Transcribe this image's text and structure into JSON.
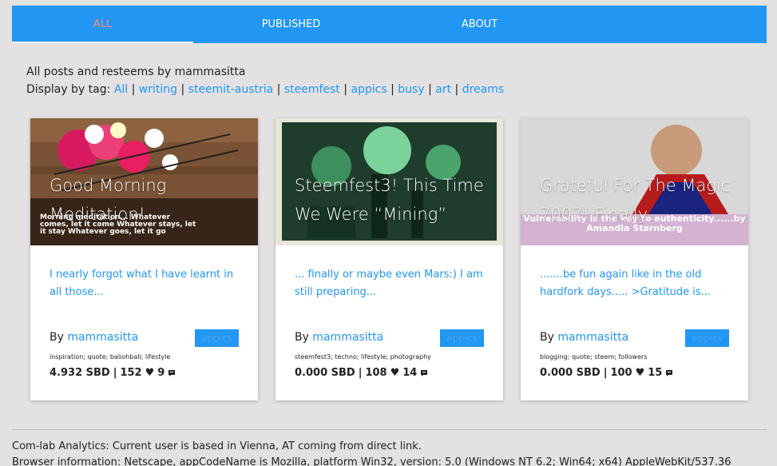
{
  "nav": {
    "tabs": [
      {
        "label": "ALL"
      },
      {
        "label": "PUBLISHED"
      },
      {
        "label": "ABOUT"
      }
    ]
  },
  "intro": {
    "line1": "All posts and resteems by mammasitta",
    "display_prefix": "Display by tag:",
    "tags": [
      "All",
      "writing",
      "steemit-austria",
      "steemfest",
      "appics",
      "busy",
      "art",
      "dreams"
    ]
  },
  "cards": [
    {
      "title": "Good Morning Meditation!",
      "image_caption": "Morning meditation... Whatever comes, let it come Whatever stays, let it stay Whatever goes, let it go",
      "excerpt": "I nearly forgot what I have learnt in all those...",
      "by_prefix": "By",
      "author": "mammasitta",
      "tag_button": "appics",
      "tags": "inspiration; quote; baliohbali; lifestyle",
      "amount": "4.932 SBD",
      "likes": "152",
      "comments": "9"
    },
    {
      "title": "Steemfest3! This Time We Were “Mining”",
      "image_caption": "",
      "excerpt": "... finally or maybe even Mars:) I am still preparing...",
      "by_prefix": "By",
      "author": "mammasitta",
      "tag_button": "appics",
      "tags": "steemfest3; techno; lifestyle; photography",
      "amount": "0.000 SBD",
      "likes": "108",
      "comments": "14"
    },
    {
      "title": "Grateful For The Magic 7007! Finally...",
      "image_caption": "Vulnerability is the key to authenticity......by Amandla Starnberg",
      "excerpt": ".......be fun again like in the old hardfork days..... >Gratitude is...",
      "by_prefix": "By",
      "author": "mammasitta",
      "tag_button": "appics",
      "tags": "blogging; quote; steem; followers",
      "amount": "0.000 SBD",
      "likes": "100",
      "comments": "15"
    }
  ],
  "footer": {
    "line1": "Com-lab Analytics: Current user is based in Vienna, AT coming from direct link.",
    "line2": "Browser information: Netscape, appCodeName is Mozilla, platform Win32, version: 5.0 (Windows NT 6.2; Win64; x64) AppleWebKit/537.36"
  },
  "colors": {
    "accent": "#2196f3",
    "active_tab_text": "#ff8a80",
    "background": "#e3e1e2"
  }
}
